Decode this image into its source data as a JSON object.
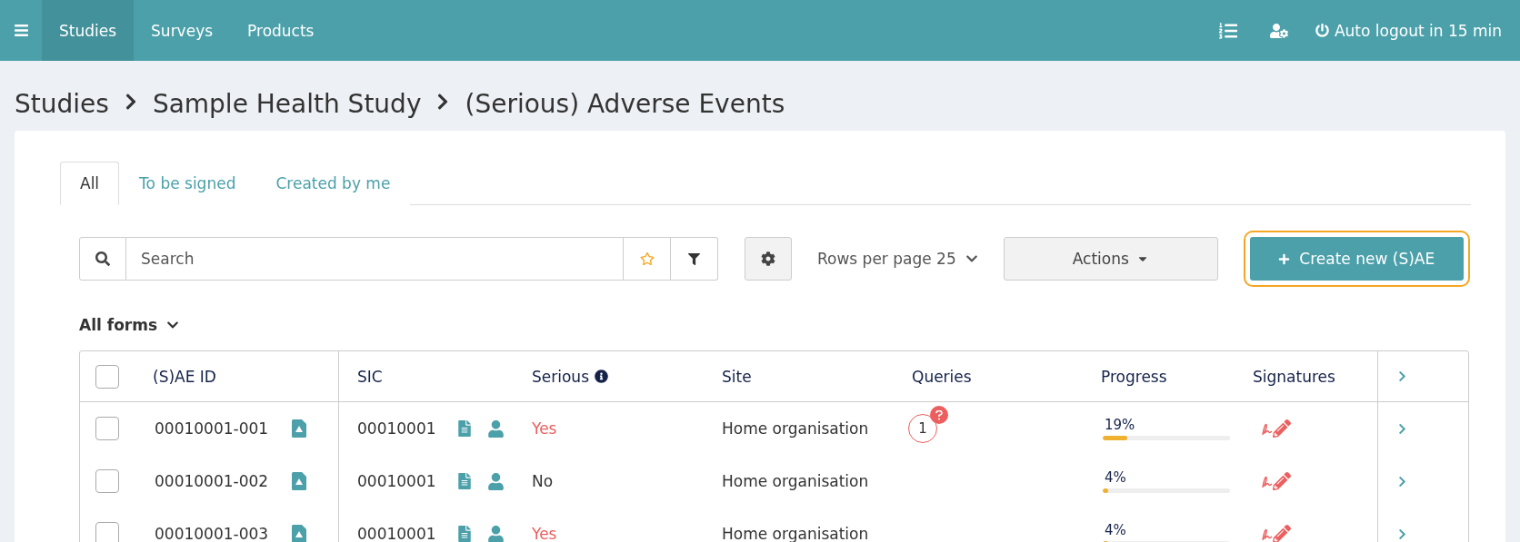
{
  "nav": {
    "items": [
      {
        "label": "Studies",
        "selected": true
      },
      {
        "label": "Surveys",
        "selected": false
      },
      {
        "label": "Products",
        "selected": false
      }
    ],
    "logout": "Auto logout in 15 min"
  },
  "breadcrumb": [
    "Studies",
    "Sample Health Study",
    "(Serious) Adverse Events"
  ],
  "tabs": [
    {
      "label": "All",
      "selected": true
    },
    {
      "label": "To be signed",
      "selected": false
    },
    {
      "label": "Created by me",
      "selected": false
    }
  ],
  "search": {
    "placeholder": "Search"
  },
  "rows_per_page": "Rows per page 25",
  "actions": "Actions",
  "create_button": "Create new (S)AE",
  "forms_filter": "All forms",
  "table": {
    "all_checked": false,
    "columns": [
      "(S)AE ID",
      "SIC",
      "Serious",
      "Site",
      "Queries",
      "Progress",
      "Signatures"
    ],
    "rows": [
      {
        "checked": false,
        "id": "00010001-001",
        "sic": "00010001",
        "serious": "Yes",
        "serious_alert": true,
        "site": "Home organisation",
        "queries": "1",
        "progress": "19%",
        "level": 0.19
      },
      {
        "checked": false,
        "id": "00010001-002",
        "sic": "00010001",
        "serious": "No",
        "serious_alert": false,
        "site": "Home organisation",
        "progress": "4%",
        "level": 0.04
      },
      {
        "checked": false,
        "id": "00010001-003",
        "sic": "00010001",
        "serious": "Yes",
        "serious_alert": true,
        "site": "Home organisation",
        "progress": "4%",
        "level": 0.04
      }
    ]
  }
}
